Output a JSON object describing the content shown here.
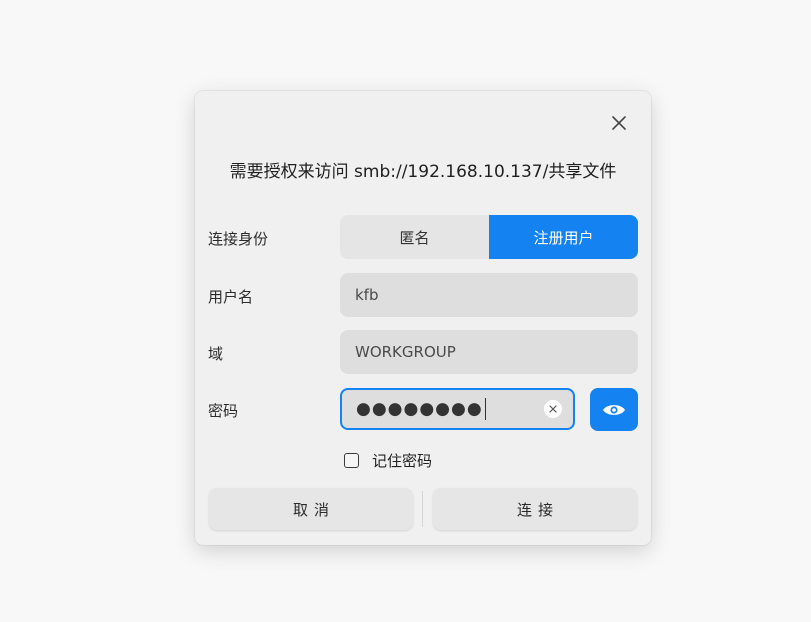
{
  "dialog": {
    "title": "需要授权来访问 smb://192.168.10.137/共享文件"
  },
  "connect_as": {
    "label": "连接身份",
    "options": [
      "匿名",
      "注册用户"
    ],
    "selected": "注册用户"
  },
  "username": {
    "label": "用户名",
    "value": "kfb"
  },
  "domain": {
    "label": "域",
    "value": "WORKGROUP"
  },
  "password": {
    "label": "密码",
    "masked_value": "●●●●●●●●"
  },
  "remember": {
    "label": "记住密码",
    "checked": false
  },
  "buttons": {
    "cancel": "取消",
    "connect": "连接"
  },
  "icons": {
    "close": "close-icon",
    "clear": "clear-icon",
    "show_password": "eye-icon"
  },
  "colors": {
    "accent": "#1482f0"
  }
}
